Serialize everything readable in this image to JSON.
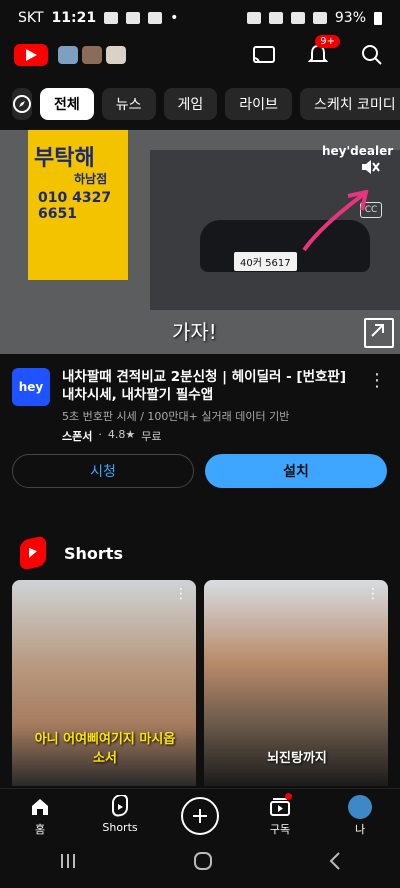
{
  "status_bar": {
    "carrier": "SKT",
    "time": "11:21",
    "dot": "•",
    "battery": "93%"
  },
  "top_bar": {
    "notification_badge": "9+"
  },
  "chips": [
    {
      "label": "전체",
      "active": true
    },
    {
      "label": "뉴스"
    },
    {
      "label": "게임"
    },
    {
      "label": "라이브"
    },
    {
      "label": "스케치 코미디"
    }
  ],
  "hero": {
    "shop_name": "부탁해",
    "shop_branch": "하남점",
    "shop_phone": "010 4327 6651",
    "plate": "40커 5617",
    "caption": "가자!",
    "brand_watermark": "hey'dealer",
    "cc_label": "CC"
  },
  "ad": {
    "logo_text": "hey",
    "title": "내차팔때 견적비교 2분신청 | 헤이딜러 - [번호판] 내차시세, 내차팔기 필수앱",
    "subtitle": "5초 번호판 시세 / 100만대+ 실거래 데이터 기반",
    "sponsor": "스폰서",
    "rating": "4.8★",
    "price": "무료",
    "watch_label": "시청",
    "install_label": "설치"
  },
  "shorts": {
    "title": "Shorts",
    "items": [
      {
        "overlay_text": "아니 어여삐여기지 마시옵소서"
      },
      {
        "overlay_text": "뇌진탕까지"
      }
    ]
  },
  "bottom_nav": [
    {
      "label": "홈",
      "icon": "home-icon"
    },
    {
      "label": "Shorts",
      "icon": "shorts-icon"
    },
    {
      "label": "",
      "icon": "create-icon"
    },
    {
      "label": "구독",
      "icon": "subscriptions-icon"
    },
    {
      "label": "나",
      "icon": "avatar"
    }
  ],
  "colors": {
    "accent_blue": "#3ea6ff",
    "youtube_red": "#ff0000",
    "background": "#0f0f0f",
    "annotation_pink": "#e8347f"
  }
}
